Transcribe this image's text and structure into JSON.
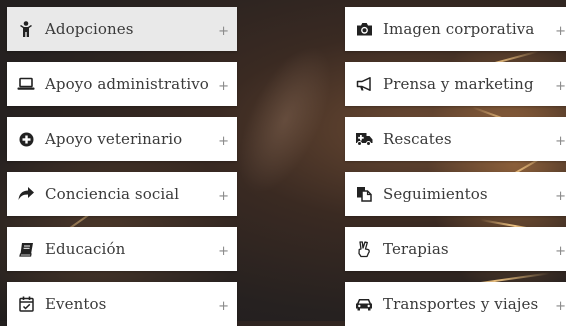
{
  "left_column": [
    {
      "label": "Adopciones",
      "icon": "child-icon",
      "toggle": "+"
    },
    {
      "label": "Apoyo administrativo",
      "icon": "laptop-icon",
      "toggle": "+"
    },
    {
      "label": "Apoyo veterinario",
      "icon": "plus-circle-icon",
      "toggle": "+"
    },
    {
      "label": "Conciencia social",
      "icon": "share-arrow-icon",
      "toggle": "+"
    },
    {
      "label": "Educación",
      "icon": "book-icon",
      "toggle": "+"
    },
    {
      "label": "Eventos",
      "icon": "calendar-check-icon",
      "toggle": "+"
    }
  ],
  "right_column": [
    {
      "label": "Imagen corporativa",
      "icon": "camera-icon",
      "toggle": "+"
    },
    {
      "label": "Prensa y marketing",
      "icon": "bullhorn-icon",
      "toggle": "+"
    },
    {
      "label": "Rescates",
      "icon": "ambulance-icon",
      "toggle": "+"
    },
    {
      "label": "Seguimientos",
      "icon": "copy-document-icon",
      "toggle": "+"
    },
    {
      "label": "Terapias",
      "icon": "peace-hand-icon",
      "toggle": "+"
    },
    {
      "label": "Transportes y viajes",
      "icon": "car-icon",
      "toggle": "+"
    }
  ],
  "colors": {
    "item_bg": "#ffffff",
    "active_item_bg": "#e9e9e9",
    "text": "#3a3a3a",
    "icon": "#222222"
  }
}
